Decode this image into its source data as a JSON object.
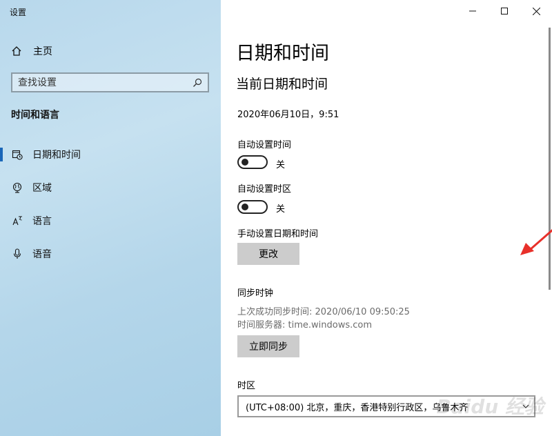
{
  "window": {
    "title": "设置"
  },
  "sidebar": {
    "home_label": "主页",
    "search_placeholder": "查找设置",
    "section_title": "时间和语言",
    "items": [
      {
        "label": "日期和时间",
        "icon": "calendar-clock-icon",
        "active": true
      },
      {
        "label": "区域",
        "icon": "globe-icon",
        "active": false
      },
      {
        "label": "语言",
        "icon": "language-icon",
        "active": false
      },
      {
        "label": "语音",
        "icon": "microphone-icon",
        "active": false
      }
    ]
  },
  "main": {
    "page_title": "日期和时间",
    "sub_title": "当前日期和时间",
    "current_datetime": "2020年06月10日，9:51",
    "auto_time": {
      "label": "自动设置时间",
      "state": "关"
    },
    "auto_timezone": {
      "label": "自动设置时区",
      "state": "关"
    },
    "manual": {
      "label": "手动设置日期和时间",
      "button": "更改"
    },
    "sync": {
      "title": "同步时钟",
      "last_sync": "上次成功同步时间: 2020/06/10 09:50:25",
      "server": "时间服务器: time.windows.com",
      "button": "立即同步"
    },
    "timezone": {
      "label": "时区",
      "value": "(UTC+08:00) 北京，重庆，香港特别行政区，乌鲁木齐"
    }
  },
  "colors": {
    "accent": "#1a66b8",
    "annotation_arrow": "#e8302a",
    "button_bg": "#cccccc"
  },
  "watermark": "Baidu 经验"
}
